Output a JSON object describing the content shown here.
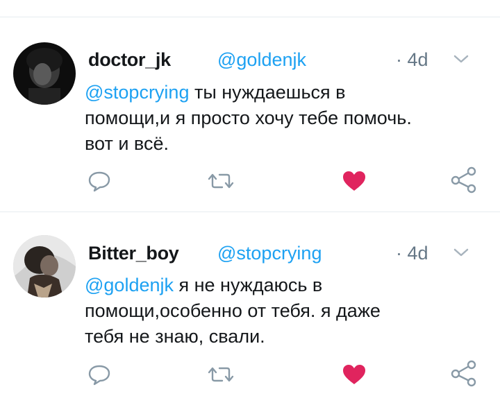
{
  "tweets": [
    {
      "display_name": "doctor_jk",
      "handle": "@goldenjk",
      "time": "· 4d",
      "reply_mention": "@stopcrying",
      "text_line1": " ты нуждаешься в",
      "text_line2": "помощи,и я просто хочу тебе помочь.",
      "text_line3": "вот и всё.",
      "icons": {
        "reply": "reply-icon",
        "retweet": "retweet-icon",
        "like": "heart-icon",
        "share": "share-icon",
        "menu": "chevron-down-icon"
      },
      "liked": true,
      "like_color": "#e0245e"
    },
    {
      "display_name": "Bitter_boy",
      "handle": "@stopcrying",
      "time": "· 4d",
      "reply_mention": "@goldenjk",
      "text_line1": " я не нуждаюсь в",
      "text_line2": "помощи,особенно от тебя. я даже",
      "text_line3": "тебя не знаю, свали.",
      "icons": {
        "reply": "reply-icon",
        "retweet": "retweet-icon",
        "like": "heart-icon",
        "share": "share-icon",
        "menu": "chevron-down-icon"
      },
      "liked": true,
      "like_color": "#e0245e"
    }
  ],
  "colors": {
    "link": "#1da1f2",
    "text": "#14171a",
    "muted": "#657786",
    "icon": "#8899a6",
    "divider": "#e6ecf0"
  }
}
